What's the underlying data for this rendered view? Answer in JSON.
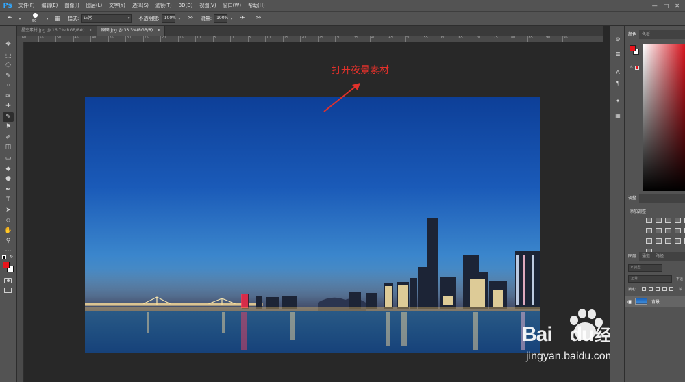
{
  "app": {
    "logo": "Ps"
  },
  "menu": [
    "文件(F)",
    "编辑(E)",
    "图像(I)",
    "图层(L)",
    "文字(Y)",
    "选择(S)",
    "滤镜(T)",
    "3D(D)",
    "视图(V)",
    "窗口(W)",
    "帮助(H)"
  ],
  "options": {
    "brush_size": "50",
    "mode_label": "模式:",
    "mode_value": "正常",
    "opacity_label": "不透明度:",
    "opacity_value": "100%",
    "flow_label": "流量:",
    "flow_value": "100%"
  },
  "tabs": [
    {
      "label": "星空素材.jpg @ 16.7%(RGB/8#)",
      "close": "×",
      "active": false
    },
    {
      "label": "原图.jpg @ 33.3%(RGB/8)",
      "close": "×",
      "active": true
    }
  ],
  "ruler": {
    "numbers": [
      "60",
      "55",
      "50",
      "45",
      "40",
      "35",
      "30",
      "25",
      "20",
      "15",
      "10",
      "5",
      "0",
      "5",
      "10",
      "15",
      "20",
      "25",
      "30",
      "35",
      "40",
      "45",
      "50",
      "55",
      "60",
      "65",
      "70",
      "75",
      "80",
      "85",
      "90",
      "95"
    ]
  },
  "annotation": {
    "text": "打开夜景素材",
    "color": "#e2312b"
  },
  "colors": {
    "foreground": "#e8141c",
    "background": "#ffffff",
    "accent_blue": "#31a8ff"
  },
  "panels": {
    "color_tabs": [
      "颜色",
      "色板"
    ],
    "adjust_tab": "调整",
    "adjust_title": "添加调整",
    "layer_tabs": [
      "图层",
      "通道",
      "路径"
    ],
    "kind_placeholder": "P 类型",
    "blend_mode": "正常",
    "opacity_short": "不透",
    "lock_label": "锁定:",
    "fill_short": "填",
    "layer_name": "背景"
  },
  "watermark": {
    "brand": "Bai",
    "brand2": "du",
    "brand_cn": "经验",
    "url": "jingyan.baidu.com"
  },
  "icons": {
    "tools": [
      "move-icon",
      "marquee-icon",
      "lasso-icon",
      "quick-select-icon",
      "crop-icon",
      "eyedropper-icon",
      "healing-icon",
      "brush-icon",
      "stamp-icon",
      "history-brush-icon",
      "eraser-icon",
      "gradient-icon",
      "blur-icon",
      "dodge-icon",
      "pen-icon",
      "type-icon",
      "path-select-icon",
      "shape-icon",
      "hand-icon",
      "zoom-icon",
      "more-icon"
    ]
  }
}
